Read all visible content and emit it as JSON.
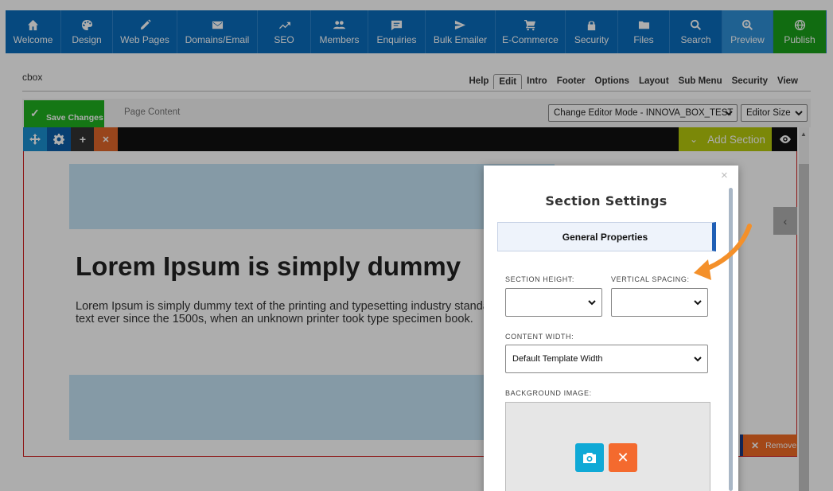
{
  "nav": [
    {
      "label": "Welcome",
      "icon": "home-icon"
    },
    {
      "label": "Design",
      "icon": "palette-icon"
    },
    {
      "label": "Web Pages",
      "icon": "pencil-icon"
    },
    {
      "label": "Domains/Email",
      "icon": "envelope-icon"
    },
    {
      "label": "SEO",
      "icon": "trend-icon"
    },
    {
      "label": "Members",
      "icon": "people-icon"
    },
    {
      "label": "Enquiries",
      "icon": "chat-icon"
    },
    {
      "label": "Bulk Emailer",
      "icon": "send-icon"
    },
    {
      "label": "E-Commerce",
      "icon": "cart-icon"
    },
    {
      "label": "Security",
      "icon": "lock-icon"
    },
    {
      "label": "Files",
      "icon": "folder-icon"
    },
    {
      "label": "Search",
      "icon": "search-icon"
    },
    {
      "label": "Preview",
      "icon": "zoom-icon"
    },
    {
      "label": "Publish",
      "icon": "globe-icon"
    }
  ],
  "page_name": "cbox",
  "tabs": [
    "Help",
    "Edit",
    "Intro",
    "Footer",
    "Options",
    "Layout",
    "Sub Menu",
    "Security",
    "View"
  ],
  "active_tab": "Edit",
  "toolbar": {
    "save_label": "Save Changes",
    "page_content_label": "Page Content",
    "editor_mode": "Change Editor Mode - INNOVA_BOX_TEST",
    "editor_size": "Editor Size"
  },
  "editor": {
    "add_section": "Add Section",
    "remove": "Remove",
    "heading": "Lorem Ipsum is simply dummy",
    "body": "Lorem Ipsum is simply dummy text of the printing and typesetting industry standard dummy text ever since the 1500s, when an unknown printer took type specimen book."
  },
  "modal": {
    "title": "Section Settings",
    "tab_general": "General Properties",
    "section_height_label": "SECTION HEIGHT:",
    "section_height_value": "",
    "vertical_spacing_label": "VERTICAL SPACING:",
    "vertical_spacing_value": "",
    "content_width_label": "CONTENT WIDTH:",
    "content_width_value": "Default Template Width",
    "background_image_label": "BACKGROUND IMAGE:",
    "close": "×"
  },
  "colors": {
    "nav_blue": "#0a6cbb",
    "publish_green": "#1a9f1a",
    "save_green": "#1fb01f",
    "add_section": "#b5c90d",
    "remove_orange": "#f06a24",
    "arrow_orange": "#f4902a"
  }
}
